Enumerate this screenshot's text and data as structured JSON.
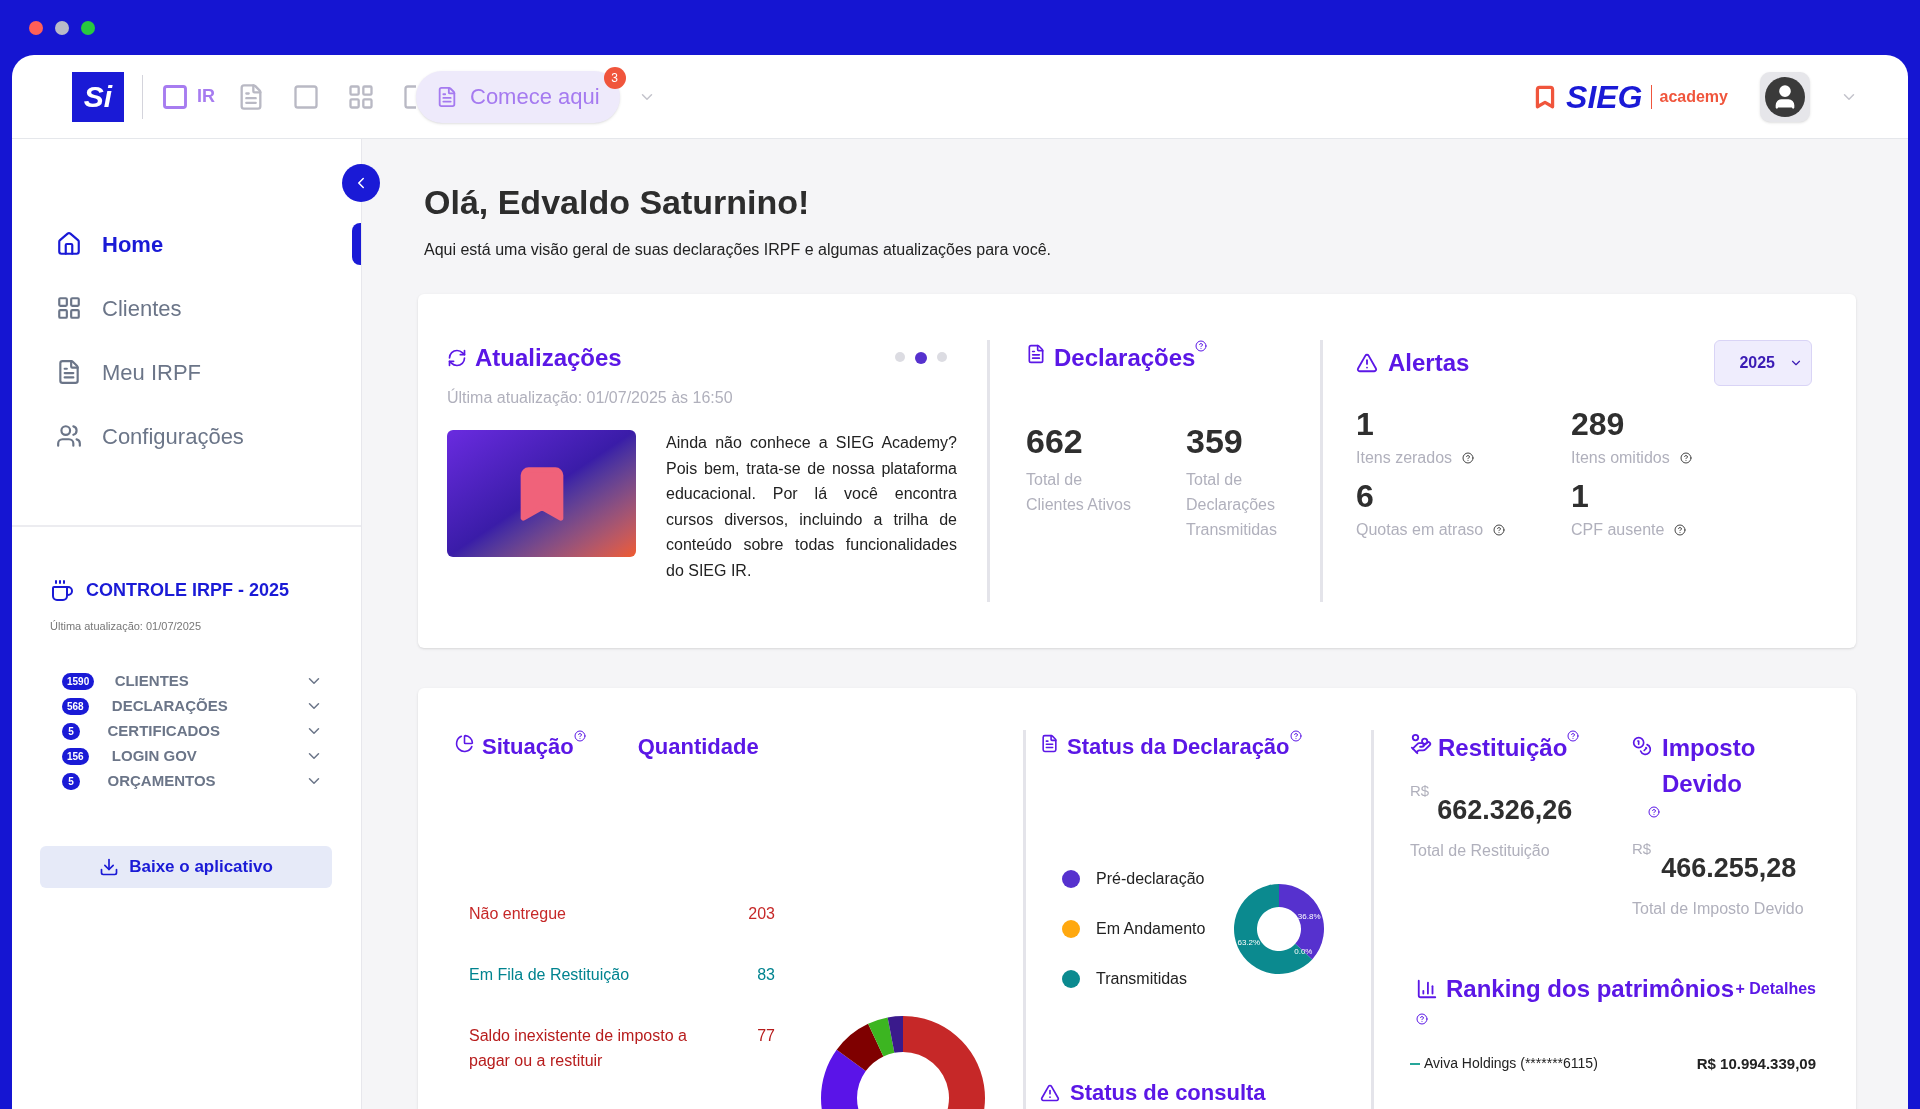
{
  "topbar": {
    "logo": "Si",
    "product": {
      "label": "IR",
      "selected": true
    },
    "start_button": {
      "label": "Comece aqui",
      "badge": "3"
    },
    "brand": {
      "name": "SIEG",
      "sub": "academy"
    }
  },
  "sidebar": {
    "nav": [
      {
        "label": "Home",
        "selected": true
      },
      {
        "label": "Clientes",
        "selected": false
      },
      {
        "label": "Meu IRPF",
        "selected": false
      },
      {
        "label": "Configurações",
        "selected": false
      }
    ],
    "control": {
      "title": "CONTROLE IRPF - 2025",
      "updated": "Última atualização: 01/07/2025",
      "items": [
        {
          "count": "1590",
          "label": "CLIENTES",
          "expanded": false
        },
        {
          "count": "568",
          "label": "DECLARAÇÕES",
          "expanded": false
        },
        {
          "count": "5",
          "label": "CERTIFICADOS",
          "expanded": false
        },
        {
          "count": "156",
          "label": "LOGIN GOV",
          "expanded": false
        },
        {
          "count": "5",
          "label": "ORÇAMENTOS",
          "expanded": false
        }
      ]
    },
    "download_button": "Baixe o aplicativo"
  },
  "greeting": "Olá, Edvaldo Saturnino!",
  "subtitle": "Aqui está uma visão geral de suas declarações IRPF e algumas atualizações para você.",
  "updates": {
    "title": "Atualizações",
    "dots": [
      {
        "selected": false
      },
      {
        "selected": true
      },
      {
        "selected": false
      }
    ],
    "updated": "Última atualização: 01/07/2025 às 16:50",
    "text": "Ainda não conhece a SIEG Academy? Pois bem, trata-se de nossa plataforma educacional. Por lá você encontra cursos diversos, incluindo a trilha de conteúdo sobre todas funcionalidades do SIEG IR."
  },
  "declaracoes": {
    "title": "Declarações",
    "stats": [
      {
        "value": "662",
        "label": "Total de Clientes Ativos"
      },
      {
        "value": "359",
        "label": "Total de Declarações Transmitidas"
      }
    ]
  },
  "alertas": {
    "title": "Alertas",
    "year": "2025",
    "items": [
      {
        "value": "1",
        "label": "Itens zerados"
      },
      {
        "value": "289",
        "label": "Itens omitidos"
      },
      {
        "value": "6",
        "label": "Quotas em atraso"
      },
      {
        "value": "1",
        "label": "CPF ausente"
      }
    ]
  },
  "situacao": {
    "title": "Situação",
    "column_2": "Quantidade",
    "rows": [
      {
        "label": "Não entregue",
        "value": "203",
        "color": "#c62828"
      },
      {
        "label": "Em Fila de Restituição",
        "value": "83",
        "color": "#00838f"
      },
      {
        "label": "Saldo inexistente de imposto a pagar ou a restituir",
        "value": "77",
        "color": "#b71c1c"
      }
    ]
  },
  "status_declaracao": {
    "title": "Status da Declaração",
    "legend": [
      {
        "label": "Pré-declaração",
        "color": "#5631ce"
      },
      {
        "label": "Em Andamento",
        "color": "#ffa80f"
      },
      {
        "label": "Transmitidas",
        "color": "#0b8a8f"
      }
    ],
    "chart_data": {
      "type": "donut",
      "values": [
        36.8,
        0.0,
        63.2
      ],
      "data_labels": true,
      "value_labels": [
        "36.8%",
        "0.0%",
        "63.2%"
      ]
    }
  },
  "status_consulta": {
    "title": "Status de consulta"
  },
  "restituicao": {
    "title": "Restituição",
    "currency": "R$",
    "amount": "662.326,26",
    "label": "Total de Restituição"
  },
  "imposto": {
    "title": "Imposto Devido",
    "currency": "R$",
    "amount": "466.255,28",
    "label": "Total de Imposto Devido"
  },
  "ranking": {
    "title": "Ranking dos patrimônios",
    "link": "+ Detalhes",
    "rows": [
      {
        "name": "Aviva Holdings (*******6115)",
        "value": "R$ 10.994.339,09",
        "color": "#26a69a"
      }
    ]
  }
}
